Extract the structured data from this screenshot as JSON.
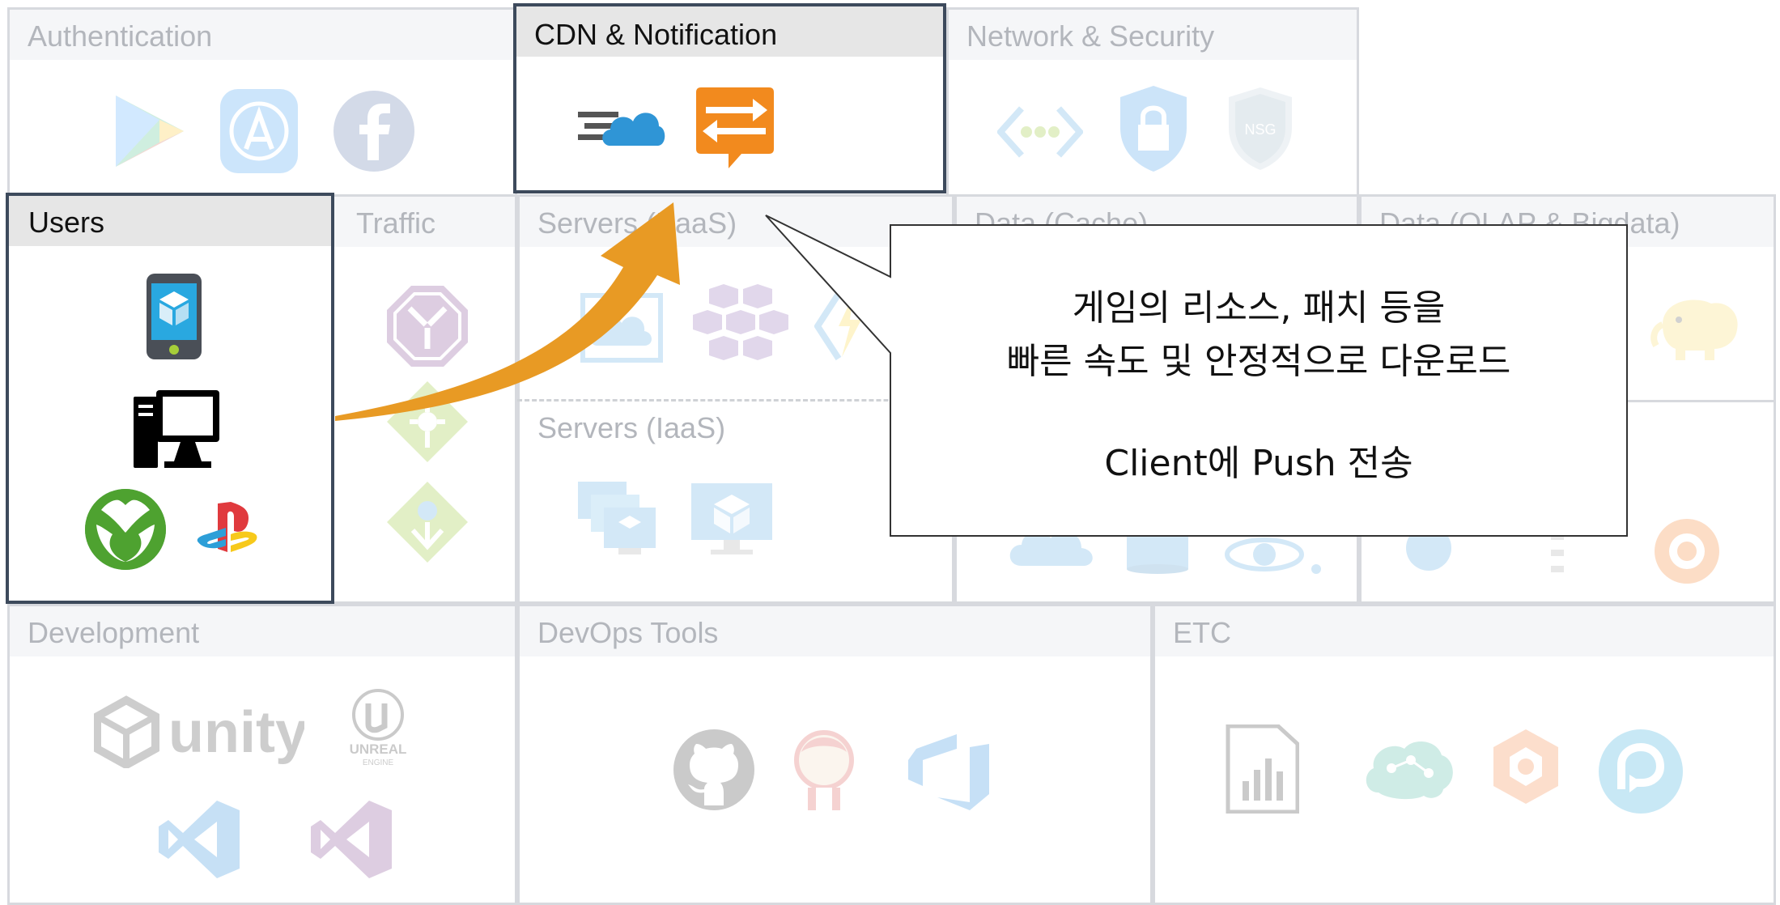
{
  "panels": {
    "authentication": "Authentication",
    "cdn_notification": "CDN & Notification",
    "network_security": "Network & Security",
    "users": "Users",
    "traffic": "Traffic",
    "servers_paas": "Servers (PaaS)",
    "data_cache": "Data (Cache)",
    "data_olap": "Data (OLAP & Bigdata)",
    "servers_iaas": "Servers (IaaS)",
    "development": "Development",
    "devops_tools": "DevOps Tools",
    "etc": "ETC"
  },
  "icons": {
    "authentication": [
      "google-play-icon",
      "app-store-icon",
      "facebook-icon"
    ],
    "cdn_notification": [
      "cdn-cloud-icon",
      "notification-hub-icon"
    ],
    "network_security": [
      "virtual-network-icon",
      "security-lock-icon",
      "nsg-icon"
    ],
    "users": [
      "mobile-device-icon",
      "desktop-pc-icon",
      "xbox-icon",
      "playstation-icon"
    ],
    "development": [
      "unity-logo",
      "unreal-engine-logo",
      "visual-studio-code-icon",
      "visual-studio-icon"
    ],
    "devops_tools": [
      "github-icon",
      "jenkins-icon",
      "azure-devops-icon"
    ],
    "etc": [
      "power-bi-icon",
      "cognitive-services-icon",
      "app-insights-icon",
      "backup-icon"
    ]
  },
  "labels": {
    "nsg": "NSG",
    "unity": "unity",
    "unreal": "UNREAL",
    "unreal_engine": "ENGINE"
  },
  "callout": {
    "line1": "게임의 리소스, 패치 등을",
    "line2": "빠른 속도 및 안정적으로 다운로드",
    "line3": "Client에 Push 전송"
  },
  "colors": {
    "highlight_border": "#3d4a5c",
    "arrow": "#e89a24",
    "panel_border": "#d7d9de",
    "cdn_blue": "#2f95d6",
    "notification_orange": "#f28a1e"
  }
}
